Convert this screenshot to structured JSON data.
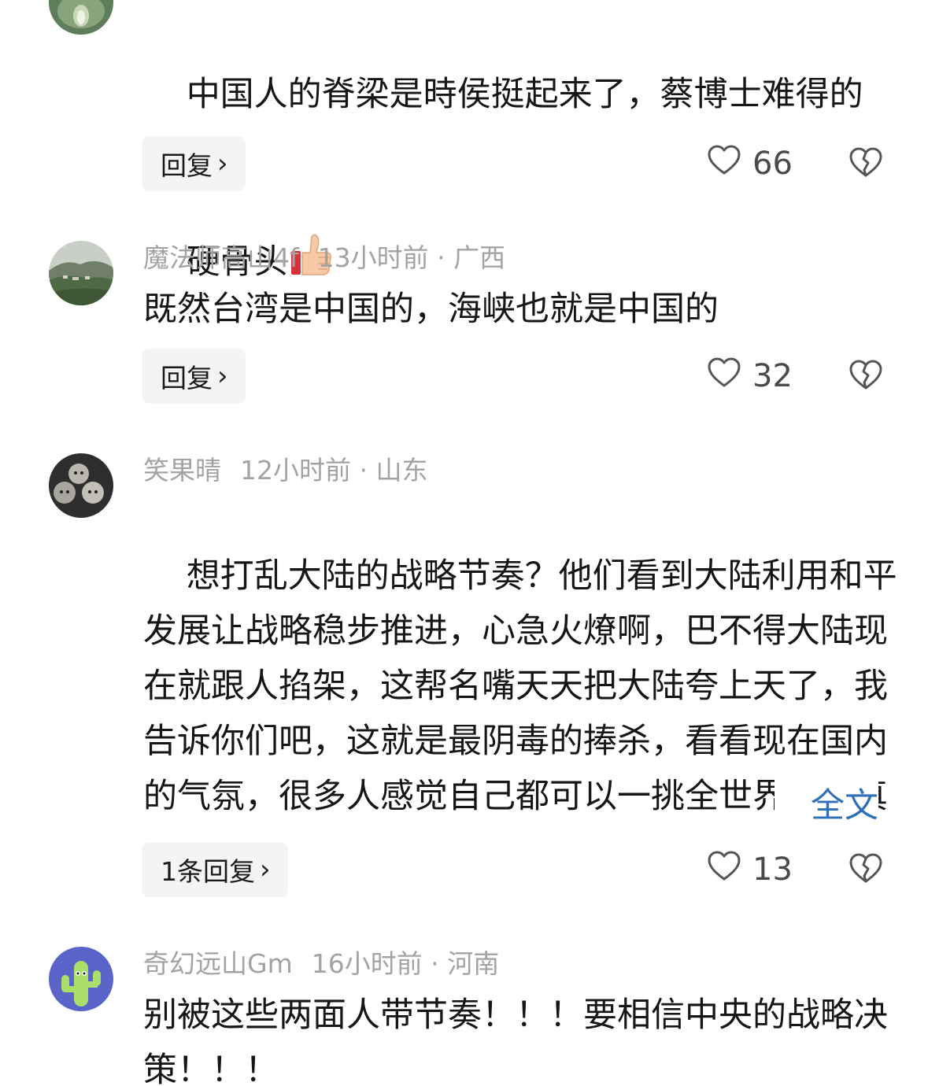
{
  "comments": [
    {
      "avatar_icon": "lotus-leaf-avatar-icon",
      "text_line1": "中国人的脊梁是時侯挺起来了，蔡博士难得的",
      "text_line2": "硬骨头",
      "emoji_icon": "thumbs-up-icon",
      "reply_label": "回复",
      "likes": "66"
    },
    {
      "username": "魔法师高山4f",
      "time": "13小时前",
      "separator": "·",
      "location": "广西",
      "avatar_icon": "mountain-landscape-avatar-icon",
      "text": "既然台湾是中国的，海峡也就是中国的",
      "reply_label": "回复",
      "likes": "32"
    },
    {
      "username": "笑果晴",
      "time": "12小时前",
      "separator": "·",
      "location": "山东",
      "avatar_icon": "kittens-avatar-icon",
      "text": "想打乱大陆的战略节奏？他们看到大陆利用和平发展让战略稳步推进，心急火燎啊，巴不得大陆现在就跟人掐架，这帮名嘴天天把大陆夸上天了，我告诉你们吧，这就是最阴毒的捧杀，看看现在国内的气氛，很多人感觉自己都可以一挑全世界了，真的很危险啊，幸",
      "more_label": "全文",
      "reply_label": "1条回复",
      "likes": "13"
    },
    {
      "username": "奇幻远山Gm",
      "time": "16小时前",
      "separator": "·",
      "location": "河南",
      "avatar_icon": "cactus-avatar-icon",
      "text": "别被这些两面人带节奏！！！要相信中央的战略决策！！！"
    }
  ],
  "colors": {
    "meta_text": "#a3a3a3",
    "link_blue": "#2f6fb7",
    "reply_bg": "#f4f4f4"
  }
}
